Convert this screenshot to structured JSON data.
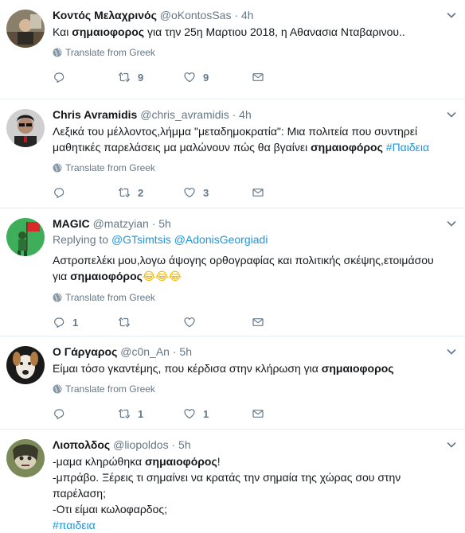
{
  "tweets": [
    {
      "name": "Κοντός Μελαχρινός",
      "handle": "@oKontosSas",
      "dot": "·",
      "time": "4h",
      "text_pre": "Και ",
      "text_bold": "σημαιοφορος",
      "text_post": " για την 25η Μαρτιου 2018, η Αθανασια Νταβαρινου..",
      "translate": "Translate from Greek",
      "replies": "",
      "retweets": "9",
      "likes": "9"
    },
    {
      "name": "Chris Avramidis",
      "handle": "@chris_avramidis",
      "dot": "·",
      "time": "4h",
      "text_line1": "Λεξικά του μέλλοντος,λήμμα \"μεταδημοκρατία\": Μια πολιτεία που συντηρεί",
      "text_line2_pre": "μαθητικές παρελάσεις μα μαλώνουν πώς θα βγαίνει ",
      "text_bold": "σημαιοφόρος",
      "hashtag": "#Παιδεια",
      "translate": "Translate from Greek",
      "replies": "",
      "retweets": "2",
      "likes": "3"
    },
    {
      "name": "MAGIC",
      "handle": "@matzyian",
      "dot": "·",
      "time": "5h",
      "replying_label": "Replying to",
      "mention1": "@GTsimtsis",
      "mention2": "@AdonisGeorgiadi",
      "text_line1": "Αστροπελέκι μου,λογω άψογης ορθογραφίας και πολιτικής σκέψης,ετοιμάσου",
      "text_line2_pre": "για ",
      "text_bold": "σημαιοφόρος",
      "emoji": "😂😂😂",
      "translate": "Translate from Greek",
      "replies": "1",
      "retweets": "",
      "likes": ""
    },
    {
      "name": "Ο Γάργαρος",
      "handle": "@c0n_An",
      "dot": "·",
      "time": "5h",
      "text_pre": "Είμαι τόσο γκαντέμης, που κέρδισα στην κλήρωση για ",
      "text_bold": "σημαιοφορος",
      "translate": "Translate from Greek",
      "replies": "",
      "retweets": "1",
      "likes": "1"
    },
    {
      "name": "Λιοπολδος",
      "handle": "@liopoldos",
      "dot": "·",
      "time": "5h",
      "line1_pre": "-μαμα κληρώθηκα ",
      "line1_bold": "σημαιοφόρος",
      "line1_post": "!",
      "line2": "-μπράβο. Ξέρεις τι σημαίνει να κρατάς την σημαία της χώρας σου στην",
      "line3": "παρέλαση;",
      "line4": "-Οτι είμαι κωλοφαρδος;",
      "hashtag": "#παιδεια"
    }
  ],
  "icons": {
    "reply": "reply-icon",
    "retweet": "retweet-icon",
    "like": "heart-icon",
    "dm": "envelope-icon",
    "globe": "globe-icon",
    "caret": "chevron-down-icon"
  },
  "colors": {
    "link": "#1b95e0",
    "muted": "#657786",
    "text": "#14171a",
    "divider": "#e6ecf0"
  }
}
